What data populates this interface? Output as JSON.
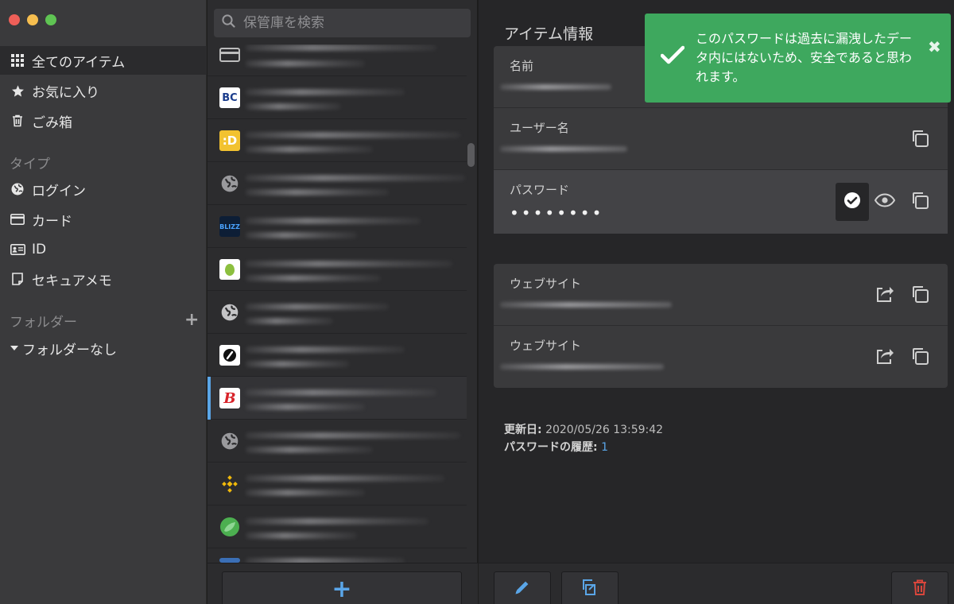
{
  "sidebar": {
    "nav": [
      {
        "label": "全てのアイテム",
        "icon": "grid-icon",
        "active": true
      },
      {
        "label": "お気に入り",
        "icon": "star-icon"
      },
      {
        "label": "ごみ箱",
        "icon": "trash-icon"
      }
    ],
    "type_section": "タイプ",
    "types": [
      {
        "label": "ログイン",
        "icon": "globe-icon"
      },
      {
        "label": "カード",
        "icon": "card-icon"
      },
      {
        "label": "ID",
        "icon": "id-card-icon"
      },
      {
        "label": "セキュアメモ",
        "icon": "note-icon"
      }
    ],
    "folder_section": "フォルダー",
    "folders": [
      {
        "label": "フォルダーなし",
        "icon": "caret-down-icon"
      }
    ]
  },
  "search": {
    "placeholder": "保管庫を検索"
  },
  "list": {
    "rows": [
      {
        "logo": "card-icon"
      },
      {
        "logo": "BC"
      },
      {
        "logo": ":D"
      },
      {
        "logo": "globe-icon"
      },
      {
        "logo": "BLIZZ"
      },
      {
        "logo": "app-logo"
      },
      {
        "logo": "globe-icon"
      },
      {
        "logo": "speedometer-logo"
      },
      {
        "logo": "B",
        "selected": true
      },
      {
        "logo": "globe-icon"
      },
      {
        "logo": "diamond-logo"
      },
      {
        "logo": "leaf-logo"
      }
    ]
  },
  "detail": {
    "title": "アイテム情報",
    "fields": {
      "name_label": "名前",
      "username_label": "ユーザー名",
      "password_label": "パスワード",
      "password_masked": "••••••••",
      "website_label_1": "ウェブサイト",
      "website_label_2": "ウェブサイト"
    },
    "meta": {
      "updated_label": "更新日:",
      "updated_value": "2020/05/26 13:59:42",
      "history_label": "パスワードの履歴:",
      "history_value": "1"
    }
  },
  "toast": {
    "message": "このパスワードは過去に漏洩したデータ内にはないため、安全であると思われます。",
    "color": "#3ea85e"
  },
  "colors": {
    "accent": "#5aa6e8",
    "danger": "#d9463c",
    "success": "#3ea85e"
  }
}
